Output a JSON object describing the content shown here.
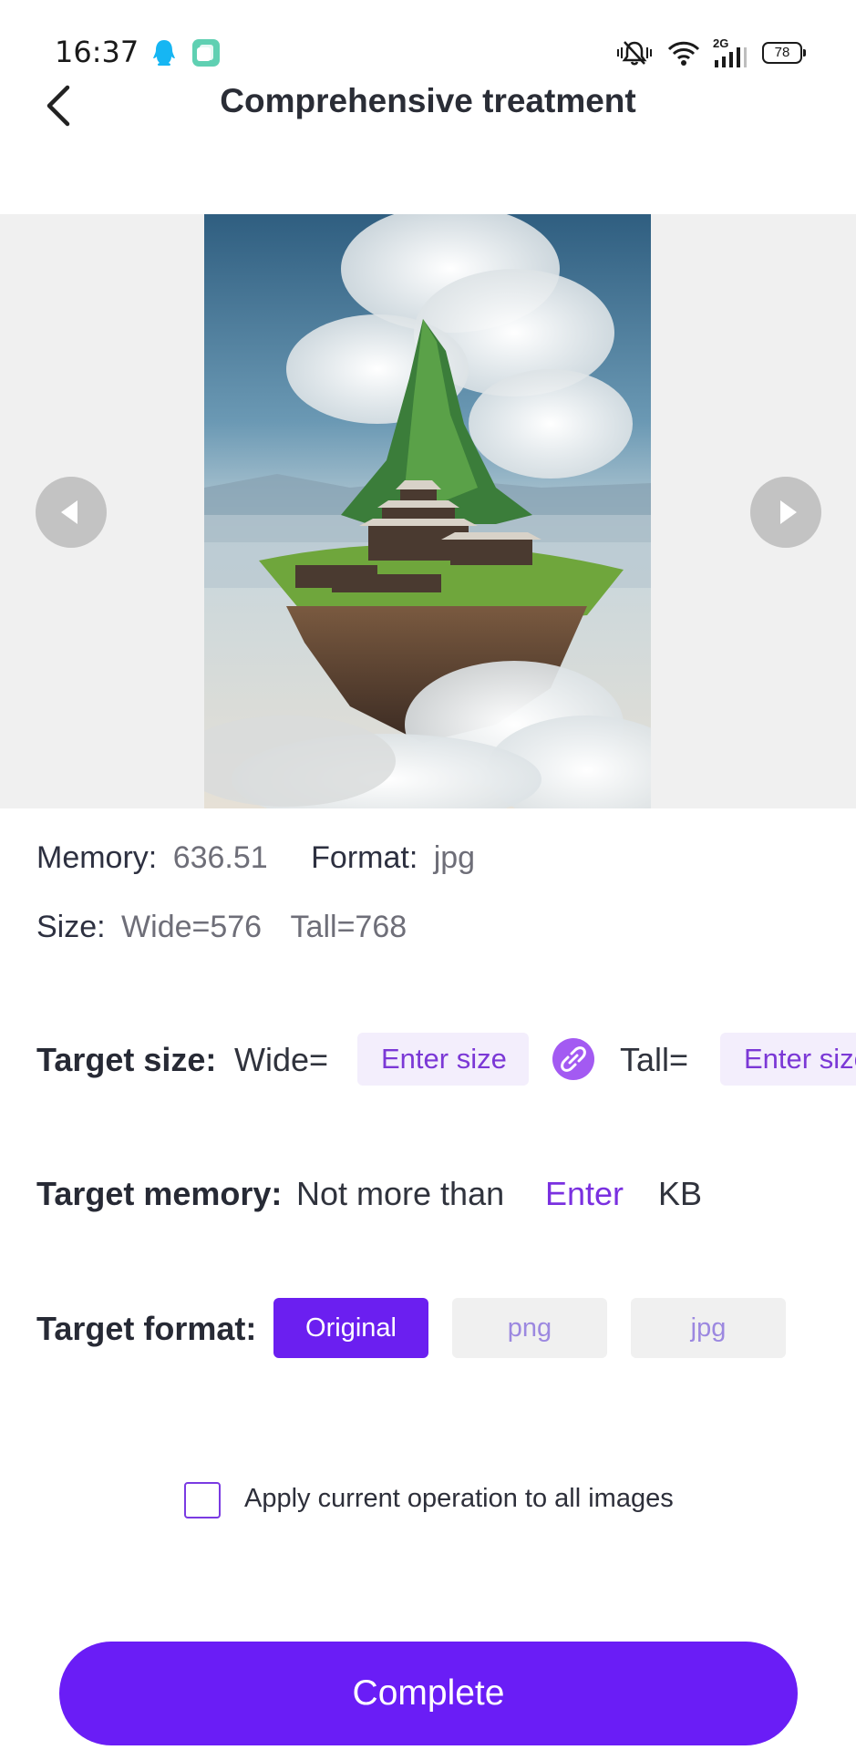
{
  "status_bar": {
    "time": "16:37",
    "network_type": "2G",
    "battery_level": "78",
    "icons": [
      "qq-icon",
      "app-icon",
      "mute-icon",
      "wifi-icon",
      "signal-icon",
      "battery-icon"
    ]
  },
  "header": {
    "title": "Comprehensive treatment",
    "back_icon": "chevron-left-icon"
  },
  "preview": {
    "prev_icon": "triangle-left-icon",
    "next_icon": "triangle-right-icon"
  },
  "info": {
    "memory_label": "Memory:",
    "memory_value": "636.51",
    "format_label": "Format:",
    "format_value": "jpg",
    "size_label": "Size:",
    "wide_value": "Wide=576",
    "tall_value": "Tall=768"
  },
  "target_size": {
    "label": "Target size:",
    "wide_label": "Wide=",
    "wide_placeholder": "Enter size",
    "tall_label": "Tall=",
    "tall_placeholder": "Enter size",
    "link_icon": "link-icon"
  },
  "target_memory": {
    "label": "Target memory:",
    "prefix": "Not more than",
    "placeholder": "Enter",
    "unit": "KB"
  },
  "target_format": {
    "label": "Target format:",
    "options": [
      "Original",
      "png",
      "jpg"
    ],
    "selected": "Original"
  },
  "apply_all": {
    "label": "Apply current operation to all images",
    "checked": false
  },
  "complete_button": {
    "label": "Complete"
  },
  "colors": {
    "accent": "#6a1df6",
    "accent_light": "#f3eefc",
    "link_text": "#7a30e0"
  }
}
